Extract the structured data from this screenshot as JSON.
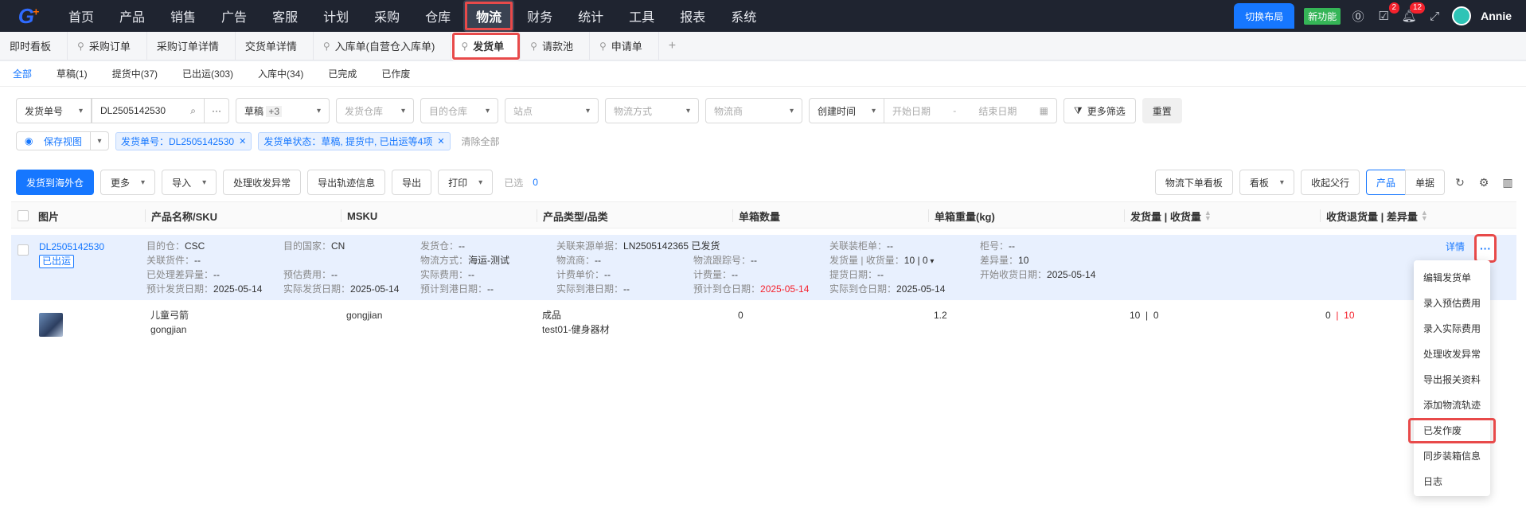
{
  "topnav": {
    "logo": "G",
    "items": [
      "首页",
      "产品",
      "销售",
      "广告",
      "客服",
      "计划",
      "采购",
      "仓库",
      "物流",
      "财务",
      "统计",
      "工具",
      "报表",
      "系统"
    ],
    "active": "物流",
    "switch_layout": "切换布局",
    "new_feature": "新功能",
    "badge_tasks": "2",
    "badge_notifications": "12",
    "user_name": "Annie"
  },
  "page_tabs": [
    {
      "label": "即时看板",
      "pinned": false
    },
    {
      "label": "采购订单",
      "pinned": true
    },
    {
      "label": "采购订单详情",
      "pinned": false
    },
    {
      "label": "交货单详情",
      "pinned": false
    },
    {
      "label": "入库单(自营仓入库单)",
      "pinned": true
    },
    {
      "label": "发货单",
      "pinned": true,
      "active": true
    },
    {
      "label": "请款池",
      "pinned": true
    },
    {
      "label": "申请单",
      "pinned": true
    }
  ],
  "status_tabs": [
    "全部",
    "草稿(1)",
    "提货中(37)",
    "已出运(303)",
    "入库中(34)",
    "已完成",
    "已作废"
  ],
  "filters": {
    "field_select": "发货单号",
    "search_value": "DL2505142530",
    "status_select": "草稿",
    "status_more": "+3",
    "ship_warehouse": "发货仓库",
    "dest_warehouse": "目的仓库",
    "site": "站点",
    "logistics_method": "物流方式",
    "carrier": "物流商",
    "time_type": "创建时间",
    "start_date": "开始日期",
    "date_sep": "-",
    "end_date": "结束日期",
    "more_filters": "更多筛选",
    "reset": "重置",
    "save_view": "保存视图",
    "tag1": "发货单号：DL2505142530",
    "tag2": "发货单状态：草稿, 提货中, 已出运等4项",
    "clear_all": "清除全部"
  },
  "toolbar": {
    "ship_overseas": "发货到海外仓",
    "more": "更多",
    "import": "导入",
    "handle_exception": "处理收发异常",
    "export_track": "导出轨迹信息",
    "export": "导出",
    "print": "打印",
    "selected_label": "已选",
    "selected_count": "0",
    "logistics_board": "物流下单看板",
    "board": "看板",
    "collapse_parent": "收起父行",
    "view_product": "产品",
    "view_order": "单据"
  },
  "table": {
    "headers": [
      "图片",
      "产品名称/SKU",
      "MSKU",
      "产品类型/品类",
      "单箱数量",
      "单箱重量(kg)",
      "发货量 | 收货量",
      "收货退货量 | 差异量"
    ]
  },
  "order": {
    "id": "DL2505142530",
    "status": "已出运",
    "details_link": "详情",
    "fields": {
      "dest_wh_k": "目的仓：",
      "dest_wh_v": "CSC",
      "linked_pieces_k": "关联货件：",
      "linked_pieces_v": "--",
      "handled_diff_k": "已处理差异量：",
      "handled_diff_v": "--",
      "est_ship_k": "预计发货日期：",
      "est_ship_v": "2025-05-14",
      "dest_country_k": "目的国家：",
      "dest_country_v": "CN",
      "est_fee_k": "预估费用：",
      "est_fee_v": "--",
      "act_ship_k": "实际发货日期：",
      "act_ship_v": "2025-05-14",
      "ship_wh_k": "发货仓：",
      "ship_wh_v": "--",
      "method_k": "物流方式：",
      "method_v": "海运-测试",
      "act_fee_k": "实际费用：",
      "act_fee_v": "--",
      "est_port_k": "预计到港日期：",
      "est_port_v": "--",
      "source_k": "关联来源单据：",
      "source_v": "LN2505142365 已发货",
      "carrier_k": "物流商：",
      "carrier_v": "--",
      "unit_price_k": "计费单价：",
      "unit_price_v": "--",
      "act_port_k": "实际到港日期：",
      "act_port_v": "--",
      "tracking_k": "物流跟踪号：",
      "tracking_v": "--",
      "billing_wt_k": "计费量：",
      "billing_wt_v": "--",
      "est_arrive_k": "预计到仓日期：",
      "est_arrive_v": "2025-05-14",
      "container_k": "关联装柜单：",
      "container_v": "--",
      "ship_recv_k": "发货量 | 收货量：",
      "ship_recv_v": "10 | 0",
      "pickup_k": "提货日期：",
      "pickup_v": "--",
      "act_arrive_k": "实际到仓日期：",
      "act_arrive_v": "2025-05-14",
      "cabinet_k": "柜号：",
      "cabinet_v": "--",
      "diff_k": "差异量：",
      "diff_v": "10",
      "start_recv_k": "开始收货日期：",
      "start_recv_v": "2025-05-14"
    }
  },
  "product": {
    "name": "儿童弓箭",
    "sku": "gongjian",
    "msku": "gongjian",
    "type": "成品",
    "category": "test01-健身器材",
    "box_qty": "0",
    "box_weight": "1.2",
    "ship_qty": "10",
    "recv_qty": "0",
    "return_qty": "0",
    "diff_qty": "10",
    "bar": "|"
  },
  "action_menu": {
    "trigger": "···",
    "items": [
      "编辑发货单",
      "录入预估费用",
      "录入实际费用",
      "处理收发异常",
      "导出报关资料",
      "添加物流轨迹",
      "已发作废",
      "同步装箱信息",
      "日志"
    ],
    "highlighted": "已发作废"
  }
}
